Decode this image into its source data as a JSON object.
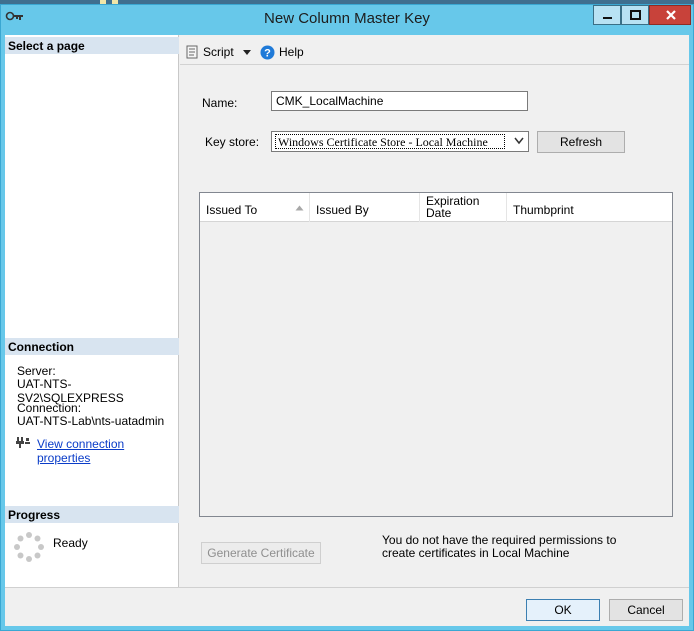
{
  "window": {
    "title": "New Column Master Key",
    "icon": "key-icon",
    "controls": [
      "minimize-icon",
      "maximize-icon",
      "close-icon"
    ]
  },
  "sidebar": {
    "select_page_header": "Select a page",
    "connection_header": "Connection",
    "server_label": "Server:",
    "server_value": "UAT-NTS-SV2\\SQLEXPRESS",
    "connection_label": "Connection:",
    "connection_value": "UAT-NTS-Lab\\nts-uatadmin",
    "view_connection_link": "View connection properties",
    "progress_header": "Progress",
    "progress_status": "Ready"
  },
  "toolbar": {
    "script_label": "Script",
    "help_label": "Help"
  },
  "form": {
    "name_label": "Name:",
    "name_value": "CMK_LocalMachine",
    "keystore_label": "Key store:",
    "keystore_value": "Windows Certificate Store - Local Machine",
    "refresh_label": "Refresh"
  },
  "table": {
    "columns": [
      "Issued To",
      "Issued By",
      "Expiration Date",
      "Thumbprint"
    ],
    "rows": []
  },
  "generate_button": "Generate Certificate",
  "permission_message": "You do not have the required permissions to create certificates in Local Machine",
  "footer": {
    "ok_label": "OK",
    "cancel_label": "Cancel"
  },
  "colors": {
    "title_bar": "#67c8ea",
    "close_button": "#c8423a",
    "section_header": "#d8e4f0",
    "link": "#0a3cc8"
  }
}
